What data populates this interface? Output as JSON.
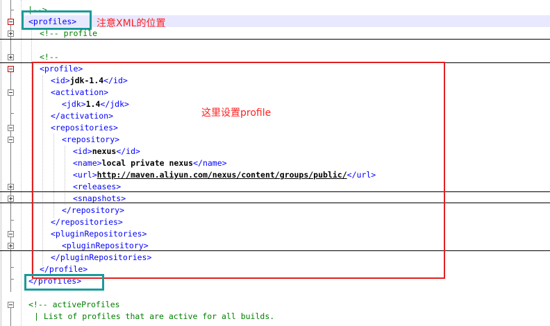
{
  "code_lines": [
    {
      "tokens": [
        {
          "t": "|-->",
          "c": "cmt"
        }
      ]
    },
    {
      "tokens": [
        {
          "t": "<profiles>",
          "c": "tag"
        }
      ]
    },
    {
      "tokens": [
        {
          "t": "<!-- profile",
          "c": "cmt"
        }
      ]
    },
    {
      "tokens": []
    },
    {
      "tokens": [
        {
          "t": "<!--",
          "c": "cmt"
        }
      ]
    },
    {
      "tokens": [
        {
          "t": "<profile>",
          "c": "tag"
        }
      ]
    },
    {
      "tokens": [
        {
          "t": "<id>",
          "c": "tag"
        },
        {
          "t": "jdk-1.4",
          "c": "txt"
        },
        {
          "t": "</id>",
          "c": "tag"
        }
      ]
    },
    {
      "tokens": [
        {
          "t": "<activation>",
          "c": "tag"
        }
      ]
    },
    {
      "tokens": [
        {
          "t": "<jdk>",
          "c": "tag"
        },
        {
          "t": "1.4",
          "c": "txt"
        },
        {
          "t": "</jdk>",
          "c": "tag"
        }
      ]
    },
    {
      "tokens": [
        {
          "t": "</activation>",
          "c": "tag"
        }
      ]
    },
    {
      "tokens": [
        {
          "t": "<repositories>",
          "c": "tag"
        }
      ]
    },
    {
      "tokens": [
        {
          "t": "<repository>",
          "c": "tag"
        }
      ]
    },
    {
      "tokens": [
        {
          "t": "<id>",
          "c": "tag"
        },
        {
          "t": "nexus",
          "c": "txt"
        },
        {
          "t": "</id>",
          "c": "tag"
        }
      ]
    },
    {
      "tokens": [
        {
          "t": "<name>",
          "c": "tag"
        },
        {
          "t": "local private nexus",
          "c": "txt"
        },
        {
          "t": "</name>",
          "c": "tag"
        }
      ]
    },
    {
      "tokens": [
        {
          "t": "<url>",
          "c": "tag"
        },
        {
          "t": "http://maven.aliyun.com/nexus/content/groups/public/",
          "c": "url"
        },
        {
          "t": "</url>",
          "c": "tag"
        }
      ]
    },
    {
      "tokens": [
        {
          "t": "<releases>",
          "c": "tag"
        }
      ]
    },
    {
      "tokens": [
        {
          "t": "<snapshots>",
          "c": "tag"
        }
      ]
    },
    {
      "tokens": [
        {
          "t": "</repository>",
          "c": "tag"
        }
      ]
    },
    {
      "tokens": [
        {
          "t": "</repositories>",
          "c": "tag"
        }
      ]
    },
    {
      "tokens": [
        {
          "t": "<pluginRepositories>",
          "c": "tag"
        }
      ]
    },
    {
      "tokens": [
        {
          "t": "<pluginRepository>",
          "c": "tag"
        }
      ]
    },
    {
      "tokens": [
        {
          "t": "</pluginRepositories>",
          "c": "tag"
        }
      ]
    },
    {
      "tokens": [
        {
          "t": "</profile>",
          "c": "tag"
        }
      ]
    },
    {
      "tokens": [
        {
          "t": "</profiles>",
          "c": "tag"
        }
      ]
    },
    {
      "tokens": []
    },
    {
      "tokens": [
        {
          "t": "<!-- activeProfiles",
          "c": "cmt"
        }
      ]
    },
    {
      "tokens": [
        {
          "t": "| List of profiles that are active for all builds.",
          "c": "cmt"
        }
      ]
    }
  ],
  "annotations": {
    "xml_position_note": "注意XML的位置",
    "profile_note": "这里设置profile"
  },
  "colors": {
    "tag": "#0000ff",
    "comment": "#008000",
    "text": "#000000",
    "teal_box": "#1a9a9a",
    "red_box": "#ff2020",
    "current_line": "#e8e8ff"
  }
}
